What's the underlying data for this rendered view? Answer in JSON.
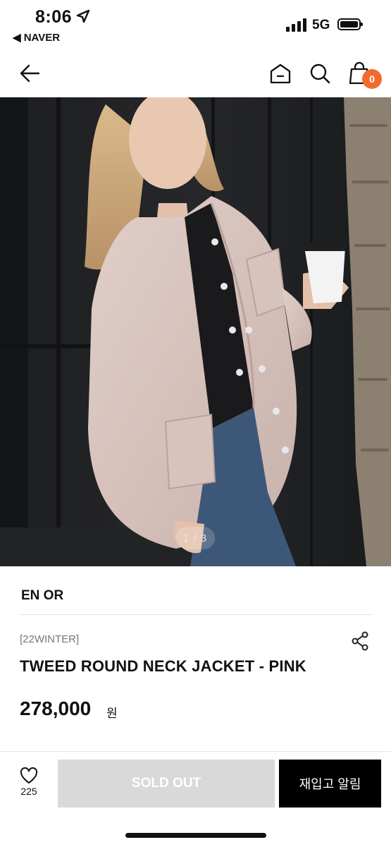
{
  "status": {
    "time": "8:06",
    "back_app": "◀ NAVER",
    "network": "5G"
  },
  "nav": {
    "cart_count": "0"
  },
  "image": {
    "pager": "1 / 3"
  },
  "product": {
    "brand": "EN OR",
    "season": "[22WINTER]",
    "name": "TWEED ROUND NECK JACKET - PINK",
    "price": "278,000",
    "currency": "원"
  },
  "actions": {
    "like_count": "225",
    "sold_out": "SOLD OUT",
    "notify": "재입고 알림"
  },
  "colors": {
    "accent": "#f26a2e",
    "primary_button": "#000000",
    "disabled_button": "#d9d9d9"
  },
  "icons": [
    "location-arrow-icon",
    "signal-icon",
    "battery-icon",
    "back-arrow-icon",
    "home-icon",
    "search-icon",
    "shopping-bag-icon",
    "share-icon",
    "heart-icon"
  ]
}
